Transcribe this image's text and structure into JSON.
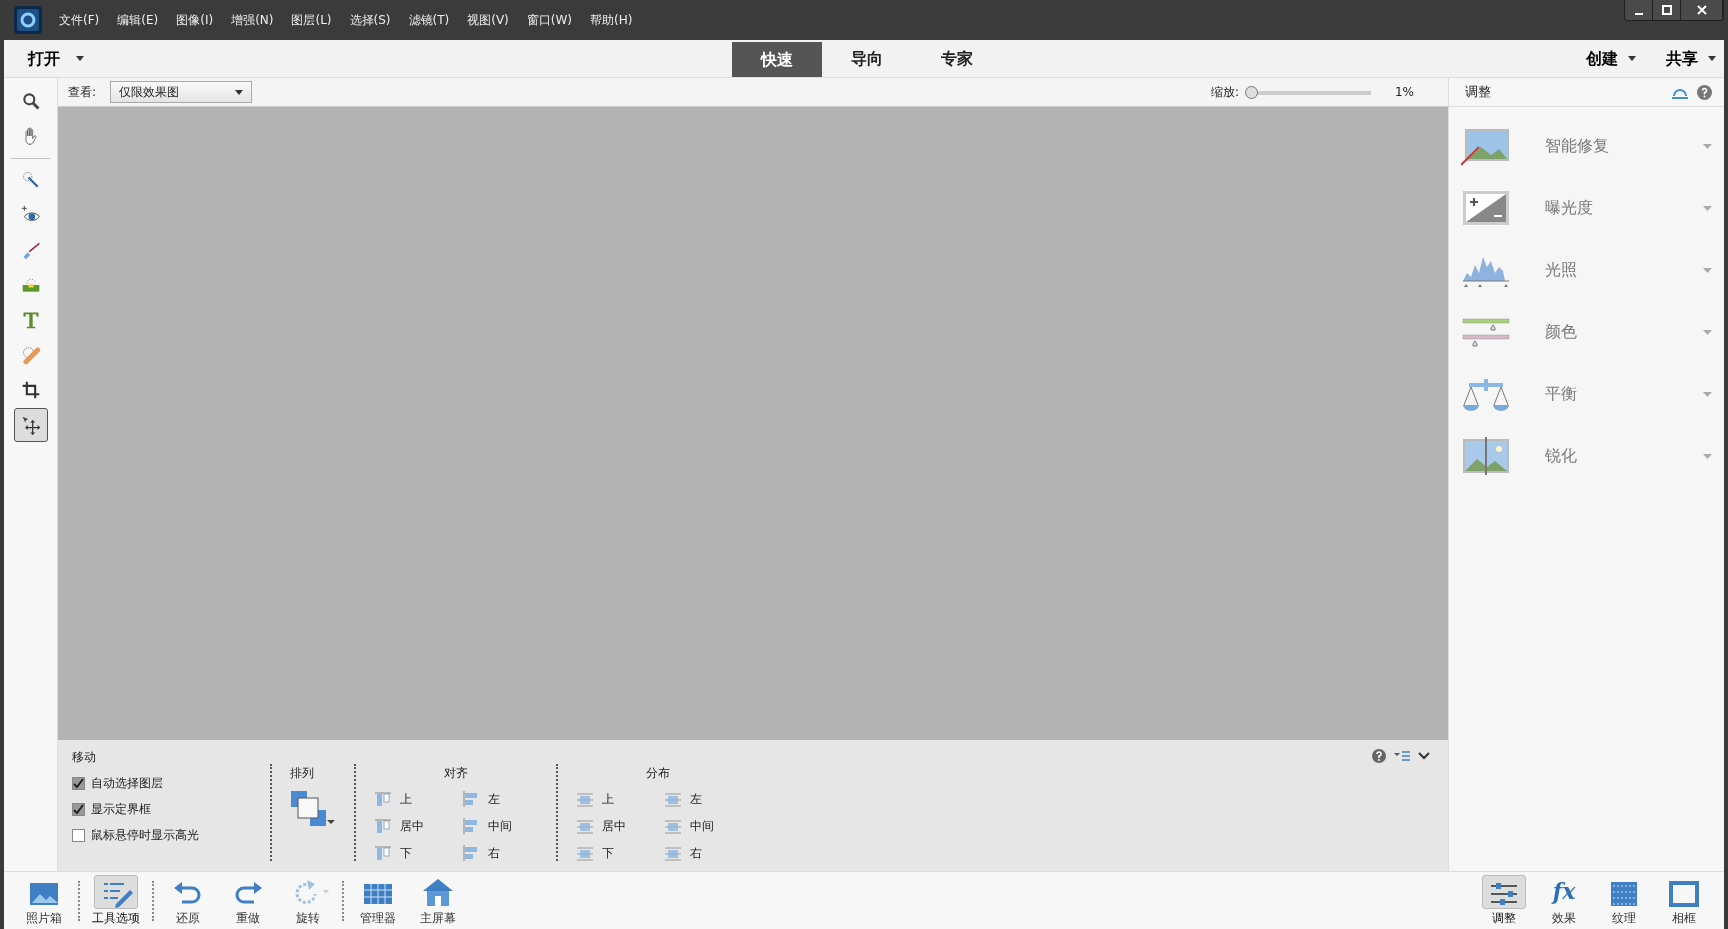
{
  "menus": [
    "文件(F)",
    "编辑(E)",
    "图像(I)",
    "增强(N)",
    "图层(L)",
    "选择(S)",
    "滤镜(T)",
    "视图(V)",
    "窗口(W)",
    "帮助(H)"
  ],
  "modebar": {
    "open": "打开",
    "tabs": [
      {
        "label": "快速",
        "selected": true
      },
      {
        "label": "导向",
        "selected": false
      },
      {
        "label": "专家",
        "selected": false
      }
    ],
    "right_menus": [
      "创建",
      "共享"
    ]
  },
  "view_bar": {
    "label": "查看:",
    "dropdown": "仅限效果图",
    "zoom_label": "缩放:",
    "zoom": {
      "level": 0.0
    },
    "zoom_reading": "1%"
  },
  "tools": [
    {
      "kind": "zoom",
      "selected": false
    },
    {
      "kind": "hand",
      "selected": false
    },
    {
      "kind": "quick-select",
      "selected": false
    },
    {
      "kind": "eye",
      "selected": false
    },
    {
      "kind": "brush",
      "selected": false
    },
    {
      "kind": "whiten",
      "selected": false
    },
    {
      "kind": "text",
      "selected": false
    },
    {
      "kind": "heal",
      "selected": false
    },
    {
      "kind": "crop",
      "selected": false
    },
    {
      "kind": "move",
      "selected": true
    }
  ],
  "adjust_panel": {
    "title": "调整",
    "items": [
      {
        "kind": "smart-fix",
        "label": "智能修复"
      },
      {
        "kind": "exposure",
        "label": "曝光度"
      },
      {
        "kind": "lighting",
        "label": "光照"
      },
      {
        "kind": "color",
        "label": "颜色"
      },
      {
        "kind": "balance",
        "label": "平衡"
      },
      {
        "kind": "sharpen",
        "label": "锐化"
      }
    ]
  },
  "tool_options": {
    "title": "移动",
    "checkboxes": [
      {
        "label": "自动选择图层",
        "checked": true
      },
      {
        "label": "显示定界框",
        "checked": true
      },
      {
        "label": "鼠标悬停时显示高光",
        "checked": false
      }
    ],
    "arrange": "排列",
    "groups": [
      {
        "title": "对齐",
        "kind": "align",
        "items": [
          "上",
          "左",
          "居中",
          "中间",
          "下",
          "右"
        ]
      },
      {
        "title": "分布",
        "kind": "distribute",
        "items": [
          "上",
          "左",
          "居中",
          "中间",
          "下",
          "右"
        ]
      }
    ]
  },
  "bottom_left": [
    {
      "kind": "photo-bin",
      "label": "照片箱",
      "selected": false,
      "disabled": false
    },
    {
      "kind": "tool-options",
      "label": "工具选项",
      "selected": true,
      "disabled": false
    },
    {
      "kind": "undo",
      "label": "还原",
      "selected": false,
      "disabled": false
    },
    {
      "kind": "redo",
      "label": "重做",
      "selected": false,
      "disabled": false
    },
    {
      "kind": "rotate",
      "label": "旋转",
      "selected": false,
      "disabled": true
    },
    {
      "kind": "organizer",
      "label": "管理器",
      "selected": false,
      "disabled": false
    },
    {
      "kind": "home",
      "label": "主屏幕",
      "selected": false,
      "disabled": false
    }
  ],
  "bottom_right": [
    {
      "kind": "adjust",
      "label": "调整",
      "selected": true
    },
    {
      "kind": "effects",
      "label": "效果",
      "selected": false,
      "glyph": "fx"
    },
    {
      "kind": "texture",
      "label": "纹理",
      "selected": false
    },
    {
      "kind": "frame",
      "label": "相框",
      "selected": false
    }
  ]
}
